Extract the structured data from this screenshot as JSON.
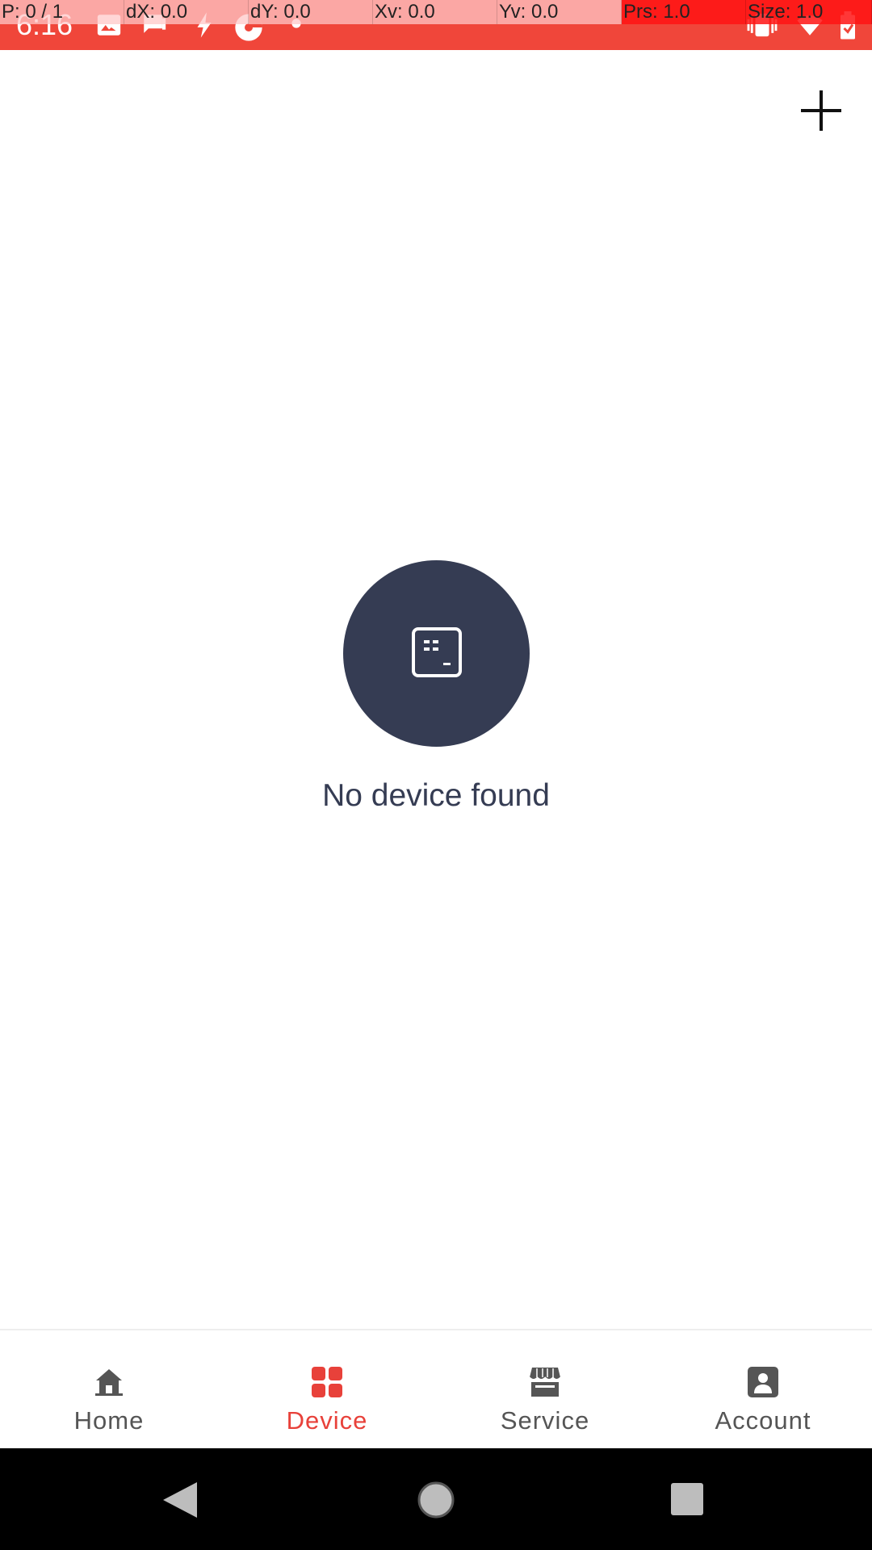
{
  "status_bar": {
    "time": "6:16",
    "background_color": "#f0463a",
    "icons": [
      "image-icon",
      "chat-icon",
      "flash-icon",
      "pie-icon",
      "dot-icon",
      "vibrate-icon",
      "wifi-icon",
      "battery-icon"
    ]
  },
  "pointer_overlay": {
    "cells": [
      "P: 0 / 1",
      "dX: 0.0",
      "dY: 0.0",
      "Xv: 0.0",
      "Yv: 0.0",
      "Prs: 1.0",
      "Size: 1.0"
    ]
  },
  "app_bar": {
    "action_icon": "plus-icon"
  },
  "empty_state": {
    "icon": "device-terminal-icon",
    "message": "No device found",
    "circle_color": "#353c53"
  },
  "bottom_nav": {
    "active_color": "#e8413a",
    "inactive_color": "#555555",
    "items": [
      {
        "label": "Home",
        "icon": "home-icon",
        "active": false
      },
      {
        "label": "Device",
        "icon": "device-grid-icon",
        "active": true
      },
      {
        "label": "Service",
        "icon": "store-icon",
        "active": false
      },
      {
        "label": "Account",
        "icon": "account-icon",
        "active": false
      }
    ]
  },
  "system_nav": {
    "buttons": [
      "back-icon",
      "home-circle-icon",
      "recents-icon"
    ]
  }
}
